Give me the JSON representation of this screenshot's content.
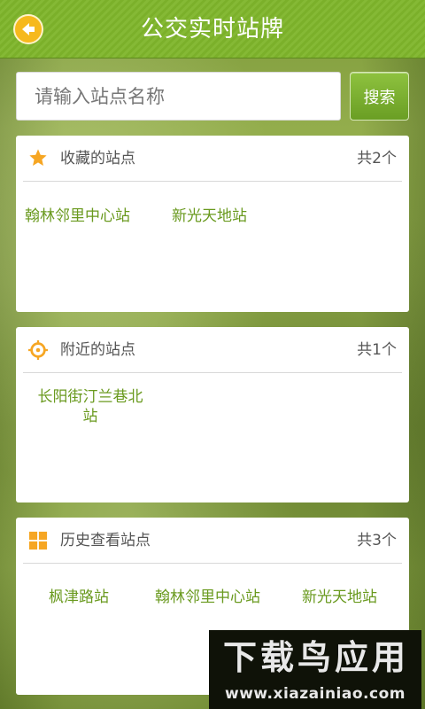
{
  "header": {
    "title": "公交实时站牌",
    "back_icon": "back-arrow-icon"
  },
  "search": {
    "placeholder": "请输入站点名称",
    "value": "",
    "button_label": "搜索"
  },
  "favorites": {
    "icon": "star-icon",
    "title": "收藏的站点",
    "count": "共2个",
    "items": [
      "翰林邻里中心站",
      "新光天地站"
    ]
  },
  "nearby": {
    "icon": "location-target-icon",
    "title": "附近的站点",
    "count": "共1个",
    "items_line1": "长阳街汀兰巷北",
    "items_line2": "站"
  },
  "history": {
    "icon": "grid-icon",
    "title": "历史查看站点",
    "count": "共3个",
    "items": [
      "枫津路站",
      "翰林邻里中心站",
      "新光天地站"
    ]
  },
  "watermark": {
    "logo_text": "下载鸟应用",
    "url": "www.xiazainiao.com"
  },
  "colors": {
    "header_green": "#7bb02a",
    "accent_orange": "#f6a623",
    "station_green": "#6a9a1f"
  }
}
